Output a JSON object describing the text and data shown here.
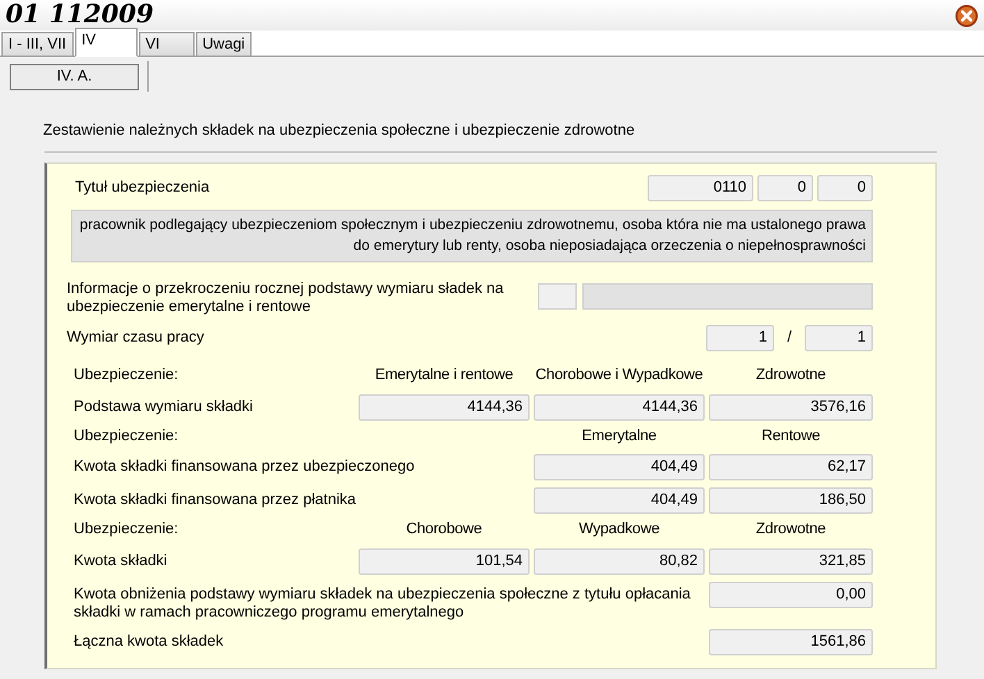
{
  "title": "01 112009",
  "tabs": [
    {
      "label": "I - III, VII",
      "selected": false
    },
    {
      "label": "IV",
      "selected": true
    },
    {
      "label": "VI",
      "selected": false
    },
    {
      "label": "Uwagi",
      "selected": false
    }
  ],
  "subtabs": [
    {
      "label": "IV. A.",
      "selected": true
    }
  ],
  "heading": "Zestawienie należnych składek na ubezpieczenia społeczne i ubezpieczenie zdrowotne",
  "insurance_title": {
    "label": "Tytuł ubezpieczenia",
    "codes": [
      "0110",
      "0",
      "0"
    ],
    "description": "pracownik podlegający ubezpieczeniom społecznym i ubezpieczeniu zdrowotnemu, osoba która nie ma ustalonego prawa do emerytury lub renty, osoba nieposiadająca orzeczenia o niepełnosprawności"
  },
  "limit_info": {
    "label": "Informacje o przekroczeniu rocznej podstawy wymiaru sładek na ubezpieczenie emerytalne i rentowe"
  },
  "working_time": {
    "label": "Wymiar czasu pracy",
    "numerator": "1",
    "separator": "/",
    "denominator": "1"
  },
  "rows": [
    {
      "kind": "header",
      "label": "Ubezpieczenie:",
      "cells": [
        "Emerytalne i rentowe",
        "Chorobowe i Wypadkowe",
        "Zdrowotne"
      ]
    },
    {
      "kind": "values",
      "label": "Podstawa wymiaru składki",
      "cells": [
        "4144,36",
        "4144,36",
        "3576,16"
      ]
    },
    {
      "kind": "header",
      "label": "Ubezpieczenie:",
      "cells": [
        "Emerytalne",
        "Rentowe"
      ]
    },
    {
      "kind": "values",
      "label": "Kwota składki finansowana przez ubezpieczonego",
      "cells": [
        "404,49",
        "62,17"
      ]
    },
    {
      "kind": "values",
      "label": "Kwota składki finansowana przez płatnika",
      "cells": [
        "404,49",
        "186,50"
      ]
    },
    {
      "kind": "header",
      "label": "Ubezpieczenie:",
      "cells": [
        "Chorobowe",
        "Wypadkowe",
        "Zdrowotne"
      ]
    },
    {
      "kind": "values",
      "label": "Kwota składki",
      "cells": [
        "101,54",
        "80,82",
        "321,85"
      ]
    },
    {
      "kind": "values",
      "label": "Kwota obniżenia podstawy wymiaru składek na ubezpieczenia społeczne z tytułu opłacania składki w ramach pracowniczego programu emerytalnego",
      "cells": [
        "0,00"
      ]
    },
    {
      "kind": "values",
      "label": "Łączna kwota składek",
      "cells": [
        "1561,86"
      ]
    }
  ]
}
